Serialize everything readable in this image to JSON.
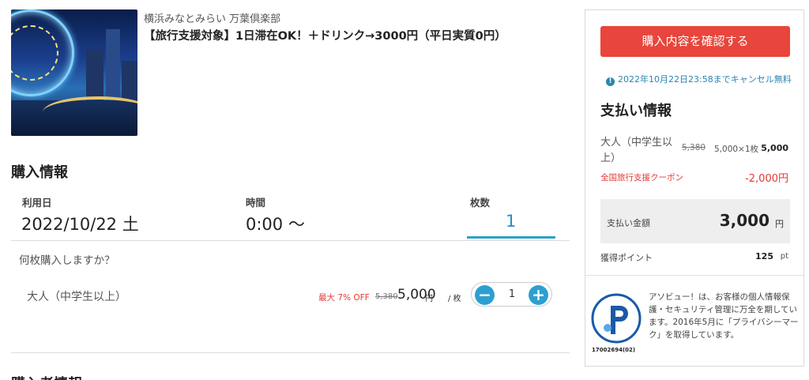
{
  "product": {
    "shop_name": "横浜みなとみらい 万葉倶楽部",
    "plan_title": "【旅行支援対象】1日滞在OK！＋ドリンク→3000円（平日実質0円）"
  },
  "purchase_info": {
    "title": "購入情報",
    "date_label": "利用日",
    "date_value": "2022/10/22 土",
    "time_label": "時間",
    "time_value": "0:00 〜",
    "qty_label": "枚数",
    "qty_value": "1",
    "question": "何枚購入しますか？",
    "ticket": {
      "name": "大人（中学生以上）",
      "discount": "最大 7% OFF",
      "original_price": "5,380",
      "price": "5,000",
      "price_unit": "円",
      "per_unit": "/ 枚",
      "quantity": "1",
      "minus_symbol": "−",
      "plus_symbol": "+"
    }
  },
  "next_section_title": "購入者情報",
  "sidebar": {
    "buy_button": "購入内容を確認する",
    "cancel_note": "2022年10月22日23:58までキャンセル無料",
    "info_icon": "!",
    "payment_title": "支払い情報",
    "line_item": {
      "label": "大人（中学生以上）",
      "original": "5,380",
      "calc": "5,000×1枚",
      "total": "5,000"
    },
    "coupon": {
      "label": "全国旅行支援クーポン",
      "value": "-2,000円"
    },
    "payment_amount": {
      "label": "支払い金額",
      "value": "3,000",
      "unit": "円"
    },
    "points": {
      "label": "獲得ポイント",
      "value": "125",
      "unit": "pt"
    },
    "privacy": {
      "mark_number": "17002694(02)",
      "text": "アソビュー！は、お客様の個人情報保護・セキュリティ管理に万全を期しています。2016年5月に「プライバシーマーク」を取得しています。"
    }
  },
  "colors": {
    "accent_blue": "#2d9fd0",
    "buy_red": "#e8453c",
    "discount_red": "#e53935",
    "link_blue": "#2a85b0"
  }
}
